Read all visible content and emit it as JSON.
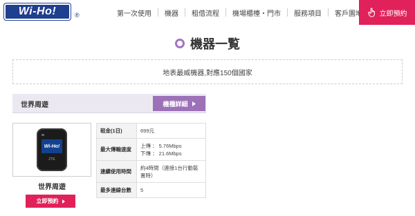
{
  "logo": {
    "text": "Wi-Ho!",
    "reg": "®"
  },
  "nav": {
    "items": [
      "第一次使用",
      "機器",
      "租借流程",
      "機場櫃檯・門市",
      "服務項目",
      "客戶園地"
    ]
  },
  "header": {
    "reserve_label": "立即預約"
  },
  "page": {
    "title": "機器一覧",
    "notice": "地表最威機器,對應150個國家"
  },
  "section": {
    "title": "世界周遊",
    "detail_label": "機種詳細"
  },
  "product": {
    "name": "世界周遊",
    "screen_text": "Wi-Ho!",
    "brand_text": "ZTE",
    "reserve_label": "立即預約"
  },
  "specs": [
    {
      "key": "租金(1日)",
      "values": [
        "699元"
      ]
    },
    {
      "key": "最大傳輸速度",
      "values": [
        "上傳 ： 5.76Mbps",
        "下傳 ： 21.6Mbps"
      ]
    },
    {
      "key": "連續使用時間",
      "values": [
        "約4時間（連接1台行動裝置時）"
      ]
    },
    {
      "key": "最多連線台數",
      "values": [
        "5"
      ]
    }
  ],
  "colors": {
    "accent_pink": "#e1215a",
    "accent_purple": "#9d71b8",
    "logo_blue": "#1f3f8f"
  },
  "icons": [
    "hand-pointer-icon",
    "chevron-right-icon",
    "title-circle-icon"
  ]
}
